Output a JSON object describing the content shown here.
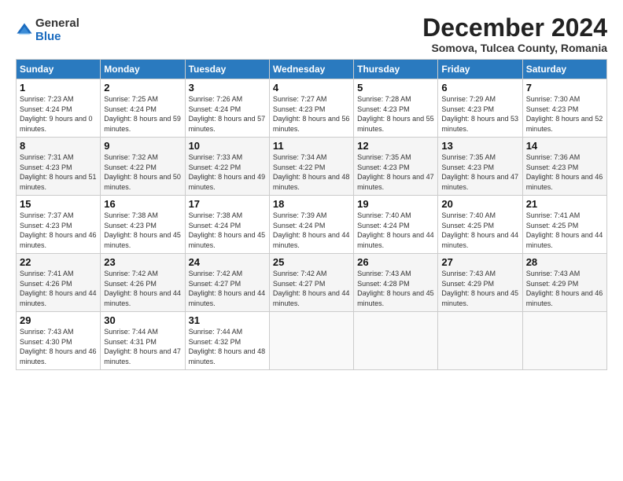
{
  "logo": {
    "general": "General",
    "blue": "Blue"
  },
  "title": "December 2024",
  "subtitle": "Somova, Tulcea County, Romania",
  "days_header": [
    "Sunday",
    "Monday",
    "Tuesday",
    "Wednesday",
    "Thursday",
    "Friday",
    "Saturday"
  ],
  "weeks": [
    [
      {
        "day": "1",
        "sunrise": "7:23 AM",
        "sunset": "4:24 PM",
        "daylight": "9 hours and 0 minutes."
      },
      {
        "day": "2",
        "sunrise": "7:25 AM",
        "sunset": "4:24 PM",
        "daylight": "8 hours and 59 minutes."
      },
      {
        "day": "3",
        "sunrise": "7:26 AM",
        "sunset": "4:24 PM",
        "daylight": "8 hours and 57 minutes."
      },
      {
        "day": "4",
        "sunrise": "7:27 AM",
        "sunset": "4:23 PM",
        "daylight": "8 hours and 56 minutes."
      },
      {
        "day": "5",
        "sunrise": "7:28 AM",
        "sunset": "4:23 PM",
        "daylight": "8 hours and 55 minutes."
      },
      {
        "day": "6",
        "sunrise": "7:29 AM",
        "sunset": "4:23 PM",
        "daylight": "8 hours and 53 minutes."
      },
      {
        "day": "7",
        "sunrise": "7:30 AM",
        "sunset": "4:23 PM",
        "daylight": "8 hours and 52 minutes."
      }
    ],
    [
      {
        "day": "8",
        "sunrise": "7:31 AM",
        "sunset": "4:23 PM",
        "daylight": "8 hours and 51 minutes."
      },
      {
        "day": "9",
        "sunrise": "7:32 AM",
        "sunset": "4:22 PM",
        "daylight": "8 hours and 50 minutes."
      },
      {
        "day": "10",
        "sunrise": "7:33 AM",
        "sunset": "4:22 PM",
        "daylight": "8 hours and 49 minutes."
      },
      {
        "day": "11",
        "sunrise": "7:34 AM",
        "sunset": "4:22 PM",
        "daylight": "8 hours and 48 minutes."
      },
      {
        "day": "12",
        "sunrise": "7:35 AM",
        "sunset": "4:23 PM",
        "daylight": "8 hours and 47 minutes."
      },
      {
        "day": "13",
        "sunrise": "7:35 AM",
        "sunset": "4:23 PM",
        "daylight": "8 hours and 47 minutes."
      },
      {
        "day": "14",
        "sunrise": "7:36 AM",
        "sunset": "4:23 PM",
        "daylight": "8 hours and 46 minutes."
      }
    ],
    [
      {
        "day": "15",
        "sunrise": "7:37 AM",
        "sunset": "4:23 PM",
        "daylight": "8 hours and 46 minutes."
      },
      {
        "day": "16",
        "sunrise": "7:38 AM",
        "sunset": "4:23 PM",
        "daylight": "8 hours and 45 minutes."
      },
      {
        "day": "17",
        "sunrise": "7:38 AM",
        "sunset": "4:24 PM",
        "daylight": "8 hours and 45 minutes."
      },
      {
        "day": "18",
        "sunrise": "7:39 AM",
        "sunset": "4:24 PM",
        "daylight": "8 hours and 44 minutes."
      },
      {
        "day": "19",
        "sunrise": "7:40 AM",
        "sunset": "4:24 PM",
        "daylight": "8 hours and 44 minutes."
      },
      {
        "day": "20",
        "sunrise": "7:40 AM",
        "sunset": "4:25 PM",
        "daylight": "8 hours and 44 minutes."
      },
      {
        "day": "21",
        "sunrise": "7:41 AM",
        "sunset": "4:25 PM",
        "daylight": "8 hours and 44 minutes."
      }
    ],
    [
      {
        "day": "22",
        "sunrise": "7:41 AM",
        "sunset": "4:26 PM",
        "daylight": "8 hours and 44 minutes."
      },
      {
        "day": "23",
        "sunrise": "7:42 AM",
        "sunset": "4:26 PM",
        "daylight": "8 hours and 44 minutes."
      },
      {
        "day": "24",
        "sunrise": "7:42 AM",
        "sunset": "4:27 PM",
        "daylight": "8 hours and 44 minutes."
      },
      {
        "day": "25",
        "sunrise": "7:42 AM",
        "sunset": "4:27 PM",
        "daylight": "8 hours and 44 minutes."
      },
      {
        "day": "26",
        "sunrise": "7:43 AM",
        "sunset": "4:28 PM",
        "daylight": "8 hours and 45 minutes."
      },
      {
        "day": "27",
        "sunrise": "7:43 AM",
        "sunset": "4:29 PM",
        "daylight": "8 hours and 45 minutes."
      },
      {
        "day": "28",
        "sunrise": "7:43 AM",
        "sunset": "4:29 PM",
        "daylight": "8 hours and 46 minutes."
      }
    ],
    [
      {
        "day": "29",
        "sunrise": "7:43 AM",
        "sunset": "4:30 PM",
        "daylight": "8 hours and 46 minutes."
      },
      {
        "day": "30",
        "sunrise": "7:44 AM",
        "sunset": "4:31 PM",
        "daylight": "8 hours and 47 minutes."
      },
      {
        "day": "31",
        "sunrise": "7:44 AM",
        "sunset": "4:32 PM",
        "daylight": "8 hours and 48 minutes."
      },
      null,
      null,
      null,
      null
    ]
  ]
}
